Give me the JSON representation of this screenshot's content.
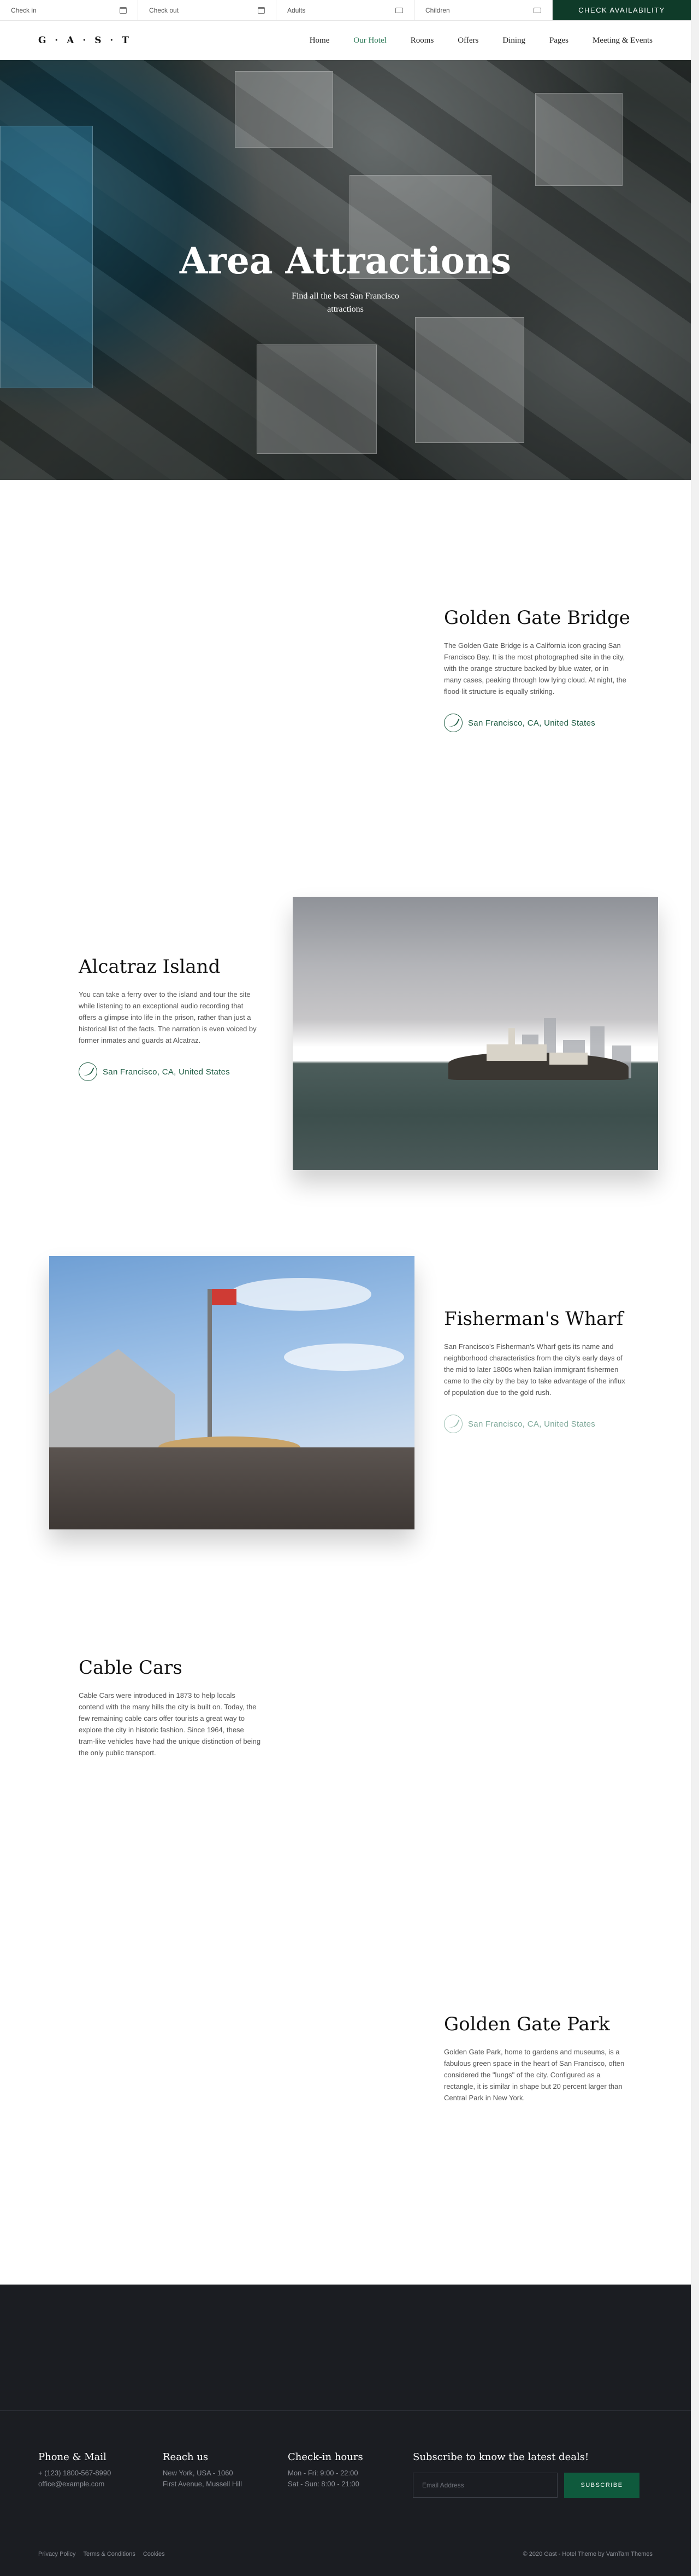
{
  "booking": {
    "check_in_placeholder": "Check in",
    "check_out_placeholder": "Check out",
    "adults_placeholder": "Adults",
    "children_placeholder": "Children",
    "check_button": "CHECK AVAILABILITY"
  },
  "nav": {
    "logo": "G · A · S · T",
    "items": [
      "Home",
      "Our Hotel",
      "Rooms",
      "Offers",
      "Dining",
      "Pages",
      "Meeting & Events"
    ],
    "active": "Our Hotel"
  },
  "hero": {
    "title": "Area Attractions",
    "subtitle": "Find all the best San Francisco attractions"
  },
  "attractions": [
    {
      "title": "Golden Gate Bridge",
      "description": "The Golden Gate Bridge is a California icon gracing San Francisco Bay. It is the most photographed site in the city, with the orange structure backed by blue water, or in many cases, peaking through low lying cloud. At night, the flood-lit structure is equally striking.",
      "location": "San Francisco, CA, United States"
    },
    {
      "title": "Alcatraz Island",
      "description": "You can take a ferry over to the island and tour the site while listening to an exceptional audio recording that offers a glimpse into life in the prison, rather than just a historical list of the facts. The narration is even voiced by former inmates and guards at Alcatraz.",
      "location": "San Francisco, CA, United States"
    },
    {
      "title": "Fisherman's Wharf",
      "description": "San Francisco's Fisherman's Wharf gets its name and neighborhood characteristics from the city's early days of the mid to later 1800s when Italian immigrant fishermen came to the city by the bay to take advantage of the influx of population due to the gold rush.",
      "location": "San Francisco, CA, United States"
    },
    {
      "title": "Cable Cars",
      "description": "Cable Cars were introduced in 1873 to help locals contend with the many hills the city is built on. Today, the few remaining cable cars offer tourists a great way to explore the city in historic fashion. Since 1964, these tram-like vehicles have had the unique distinction of being the only public transport."
    },
    {
      "title": "Golden Gate Park",
      "description": "Golden Gate Park, home to gardens and museums, is a fabulous green space in the heart of San Francisco, often considered the \"lungs\" of the city. Configured as a rectangle, it is similar in shape but 20 percent larger than Central Park in New York."
    }
  ],
  "footer": {
    "phone_mail": {
      "heading": "Phone & Mail",
      "lines": [
        "+ (123) 1800-567-8990",
        "office@example.com"
      ]
    },
    "reach_us": {
      "heading": "Reach us",
      "lines": [
        "New York, USA - 1060",
        "First Avenue, Mussell Hill"
      ]
    },
    "check_in_hours": {
      "heading": "Check-in hours",
      "lines": [
        "Mon - Fri: 9:00 - 22:00",
        "Sat - Sun: 8:00 - 21:00"
      ]
    },
    "newsletter": {
      "heading": "Subscribe to know the latest deals!",
      "email_placeholder": "Email Address",
      "button": "SUBSCRIBE"
    },
    "links": [
      "Privacy Policy",
      "Terms & Conditions",
      "Cookies"
    ],
    "copyright": "© 2020 Gast - Hotel Theme by VamTam Themes"
  }
}
